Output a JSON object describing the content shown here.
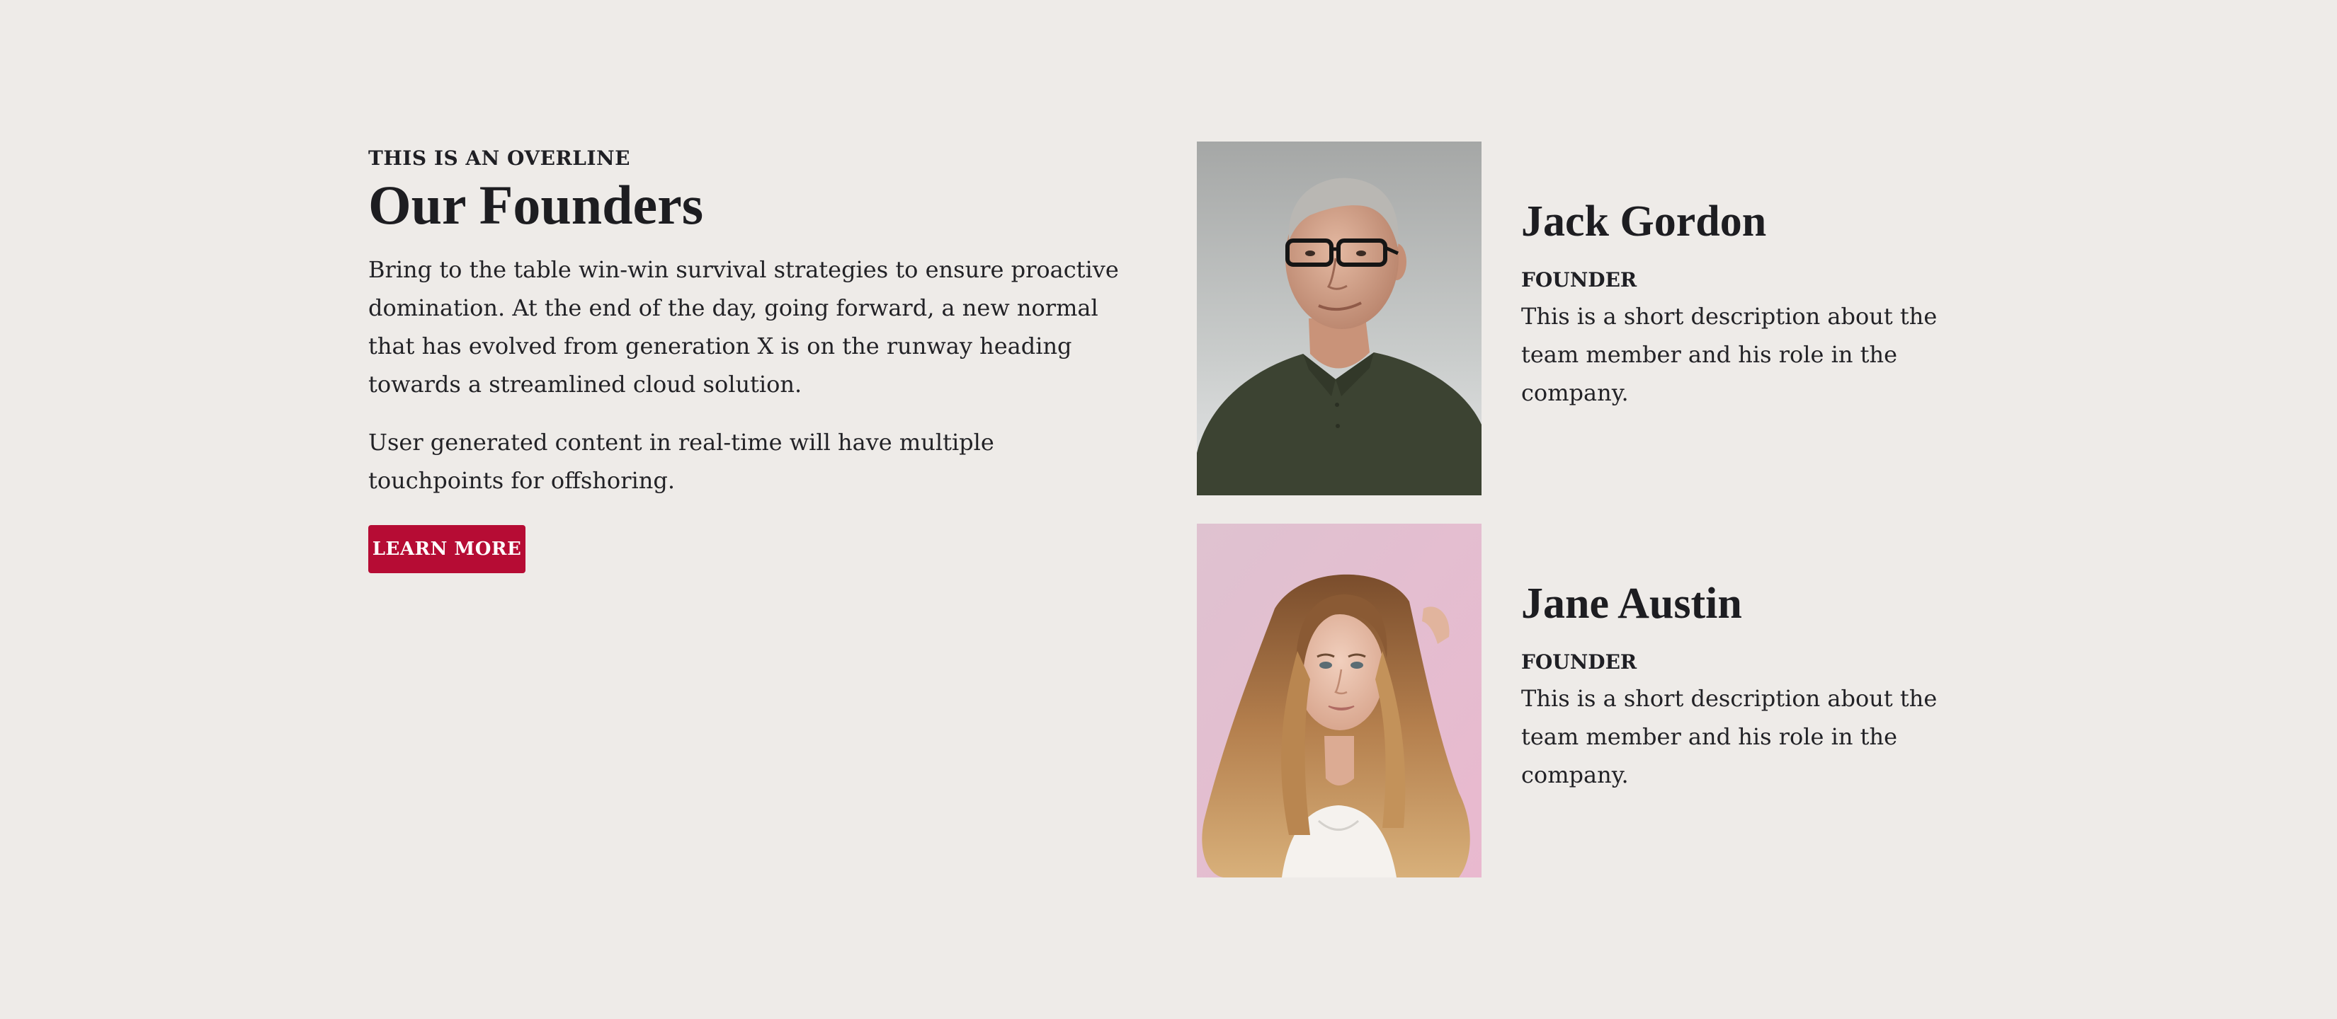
{
  "intro": {
    "overline": "THIS IS AN OVERLINE",
    "title": "Our Founders",
    "paragraph_1": "Bring to the table win-win survival strategies to ensure proactive domination. At the end of the day, going forward, a new normal that has evolved from generation X is on the runway heading towards a streamlined cloud solution.",
    "paragraph_2": "User generated content in real-time will have multiple touchpoints for offshoring.",
    "cta_label": "LEARN MORE"
  },
  "members": [
    {
      "name": "Jack Gordon",
      "role": "FOUNDER",
      "description": "This is a short description about the team member and his role in the company.",
      "photo": "portrait of a smiling older man with glasses and an olive polo shirt"
    },
    {
      "name": "Jane Austin",
      "role": "FOUNDER",
      "description": "This is a short description about the team member and his role in the company.",
      "photo": "portrait of a woman with long wavy blonde hair on a pink background"
    }
  ],
  "colors": {
    "background": "#eeebe8",
    "accent": "#b60c34",
    "text": "#1f1f24"
  }
}
